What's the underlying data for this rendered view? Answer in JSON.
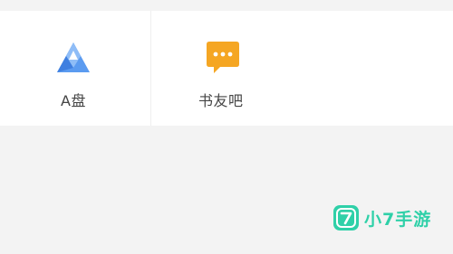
{
  "tools": [
    {
      "label": "A盘",
      "icon": "a-disk-icon",
      "color": "#5b9bf0"
    },
    {
      "label": "书友吧",
      "icon": "chat-bubble-icon",
      "color": "#f5a623"
    }
  ],
  "watermark": {
    "logo_text": "7",
    "text": "小7手游",
    "color": "#2fd0a8"
  }
}
